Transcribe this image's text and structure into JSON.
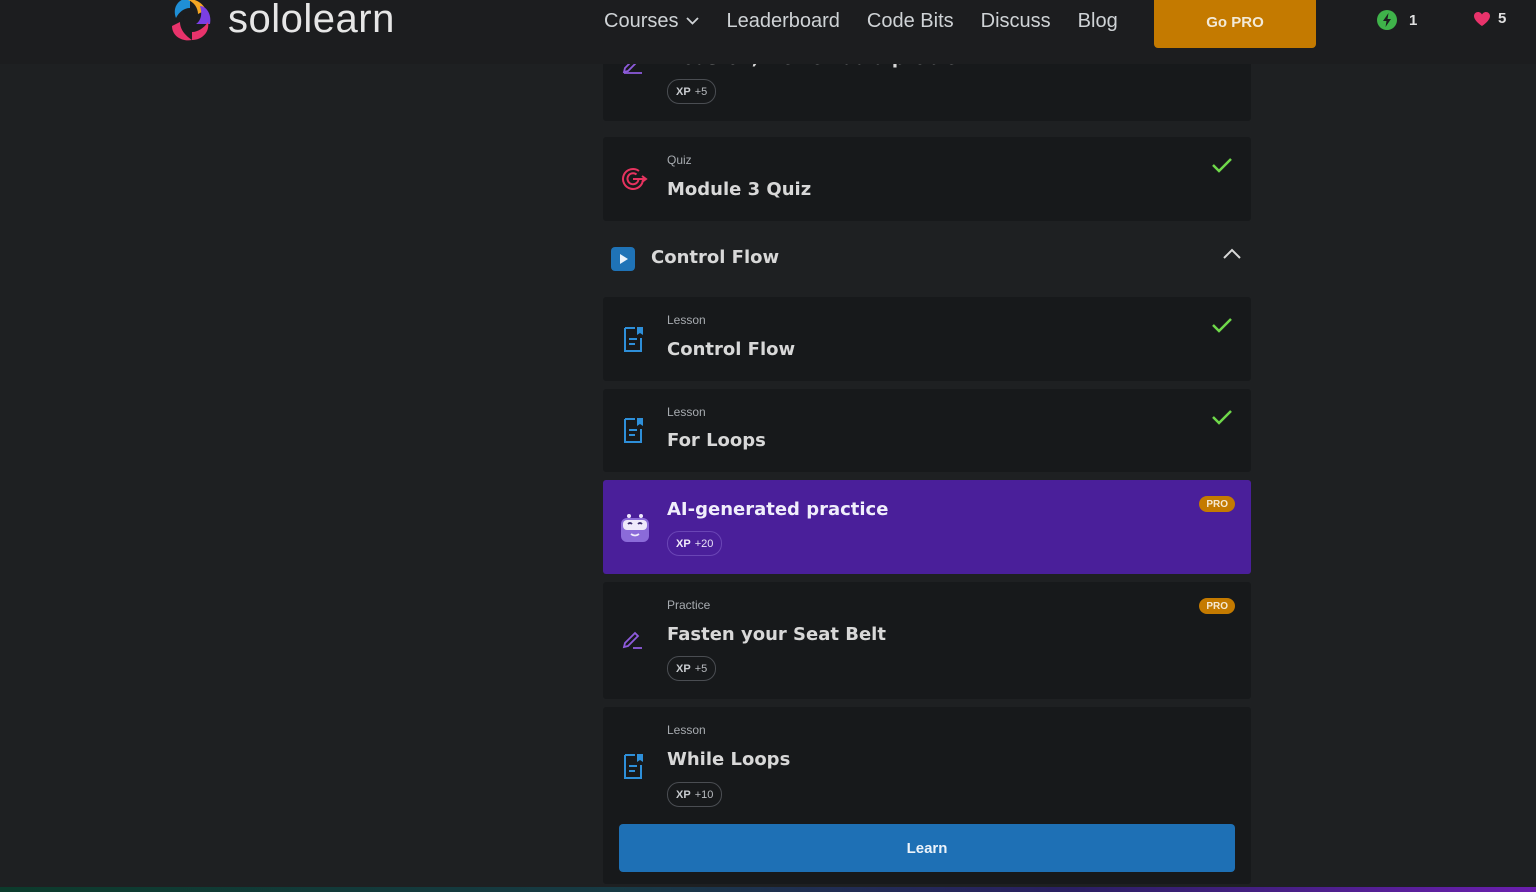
{
  "header": {
    "logo_text": "sololearn",
    "nav": [
      {
        "label": "Courses",
        "icon": "chevron-down-icon"
      },
      {
        "label": "Leaderboard"
      },
      {
        "label": "Code Bits"
      },
      {
        "label": "Discuss"
      },
      {
        "label": "Blog"
      }
    ],
    "go_pro_label": "Go PRO",
    "streak": {
      "icon": "bolt-icon",
      "count": "1"
    },
    "hearts": {
      "icon": "heart-icon",
      "count": "5"
    }
  },
  "top_card": {
    "title_partial": "Houston, we've had a problem",
    "xp_label": "XP",
    "xp_value": "+5",
    "icon": "pencil-icon"
  },
  "quiz_card": {
    "type": "Quiz",
    "title": "Module 3 Quiz",
    "icon": "target-icon",
    "completed": true
  },
  "section": {
    "title": "Control Flow",
    "icon": "play-icon",
    "expanded": true
  },
  "items": [
    {
      "type": "Lesson",
      "title": "Control Flow",
      "icon": "lesson-icon",
      "completed": true
    },
    {
      "type": "Lesson",
      "title": "For Loops",
      "icon": "lesson-icon",
      "completed": true
    }
  ],
  "ai_practice": {
    "title": "AI-generated practice",
    "xp_label": "XP",
    "xp_value": "+20",
    "badge": "PRO",
    "icon": "robot-icon"
  },
  "practice": {
    "type": "Practice",
    "title": "Fasten your Seat Belt",
    "xp_label": "XP",
    "xp_value": "+5",
    "badge": "PRO",
    "icon": "pencil-icon"
  },
  "current_lesson": {
    "type": "Lesson",
    "title": "While Loops",
    "xp_label": "XP",
    "xp_value": "+10",
    "button_label": "Learn",
    "icon": "lesson-icon"
  },
  "colors": {
    "accent_gold": "#c47a00",
    "primary_blue": "#1e70b5",
    "ai_purple": "#4a1f9a",
    "check_green": "#6fd84a",
    "heart_pink": "#e8336b"
  }
}
